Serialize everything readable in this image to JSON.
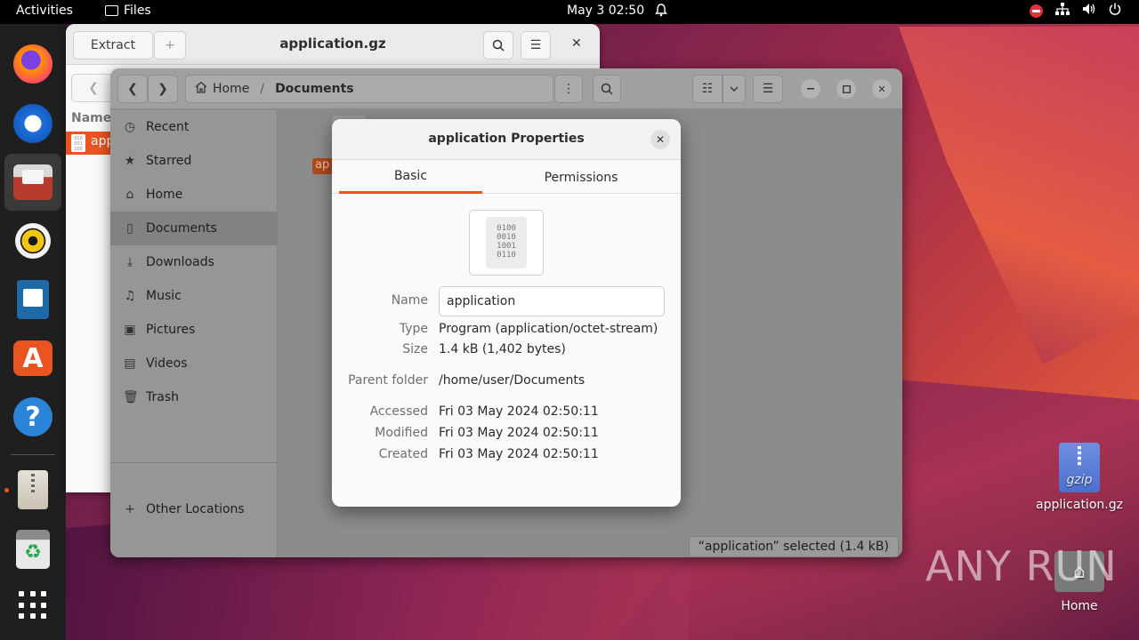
{
  "topbar": {
    "activities": "Activities",
    "app_name": "Files",
    "clock": "May 3  02:50",
    "bell_icon": "bell-icon",
    "tray_icons": [
      "stop-icon",
      "network-icon",
      "volume-icon",
      "power-icon"
    ]
  },
  "dock": {
    "items": [
      "Firefox",
      "Thunderbird",
      "Files",
      "Rhythmbox",
      "LibreOffice Writer",
      "Ubuntu Software",
      "Help",
      "Archive Manager",
      "Trash",
      "Show Applications"
    ]
  },
  "archive_window": {
    "extract_label": "Extract",
    "add_label": "+",
    "title": "application.gz",
    "list_header": "Name",
    "row_text": "app"
  },
  "files_window": {
    "path_home": "Home",
    "path_separator": "/",
    "path_current": "Documents",
    "sidebar": {
      "recent": "Recent",
      "starred": "Starred",
      "home": "Home",
      "documents": "Documents",
      "downloads": "Downloads",
      "music": "Music",
      "pictures": "Pictures",
      "videos": "Videos",
      "trash": "Trash",
      "other_locations": "Other Locations"
    },
    "file_label_partial": "ap",
    "status": "“application” selected  (1.4 kB)"
  },
  "properties": {
    "title": "application Properties",
    "tabs": {
      "basic": "Basic",
      "permissions": "Permissions"
    },
    "icon_text": [
      "0100",
      "0010",
      "1001",
      "0110"
    ],
    "labels": {
      "name": "Name",
      "type": "Type",
      "size": "Size",
      "parent": "Parent folder",
      "accessed": "Accessed",
      "modified": "Modified",
      "created": "Created"
    },
    "values": {
      "name": "application",
      "type": "Program (application/octet-stream)",
      "size": "1.4 kB (1,402 bytes)",
      "parent": "/home/user/Documents",
      "accessed": "Fri 03 May 2024 02:50:11",
      "modified": "Fri 03 May 2024 02:50:11",
      "created": "Fri 03 May 2024 02:50:11"
    }
  },
  "desktop": {
    "gz_label": "application.gz",
    "gz_icon_text": "gzip",
    "home_label": "Home"
  },
  "watermark": "ANY RUN",
  "colors": {
    "accent": "#e95420",
    "topbar": "#000000",
    "dock": "#1f1f1f"
  }
}
